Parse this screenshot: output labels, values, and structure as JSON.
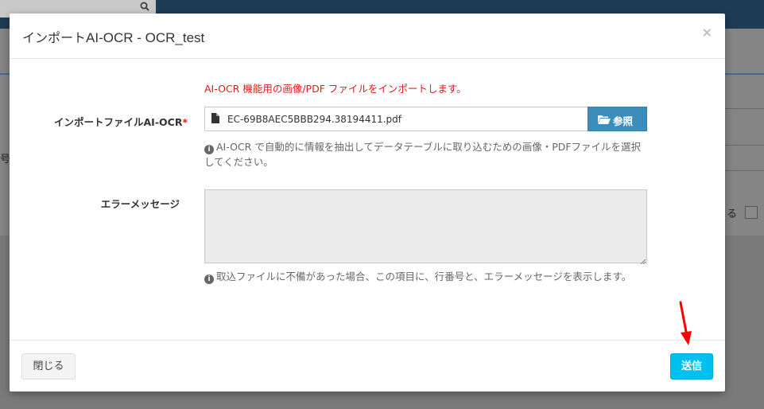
{
  "background": {
    "left_fragment": "号",
    "right_fragment": "る"
  },
  "modal": {
    "title_prefix": "インポート",
    "title_suffix": "AI-OCR - OCR_test",
    "close_symbol": "×",
    "notice": "AI-OCR 機能用の画像/PDF ファイルをインポートします。",
    "file_field": {
      "label": "インポートファイルAI-OCR",
      "required_mark": "*",
      "value": "EC-69B8AEC5BBB294.38194411.pdf",
      "browse_label": "参照",
      "help": "AI-OCR で自動的に情報を抽出してデータテーブルに取り込むための画像・PDFファイルを選択してください。"
    },
    "error_field": {
      "label": "エラーメッセージ",
      "value": "",
      "help": "取込ファイルに不備があった場合、この項目に、行番号と、エラーメッセージを表示します。"
    },
    "footer": {
      "close_label": "閉じる",
      "submit_label": "送信"
    }
  },
  "colors": {
    "primary": "#3c8dbc",
    "info": "#00c0ef",
    "danger": "#e01b1b",
    "annotation_arrow": "#ff0000"
  }
}
